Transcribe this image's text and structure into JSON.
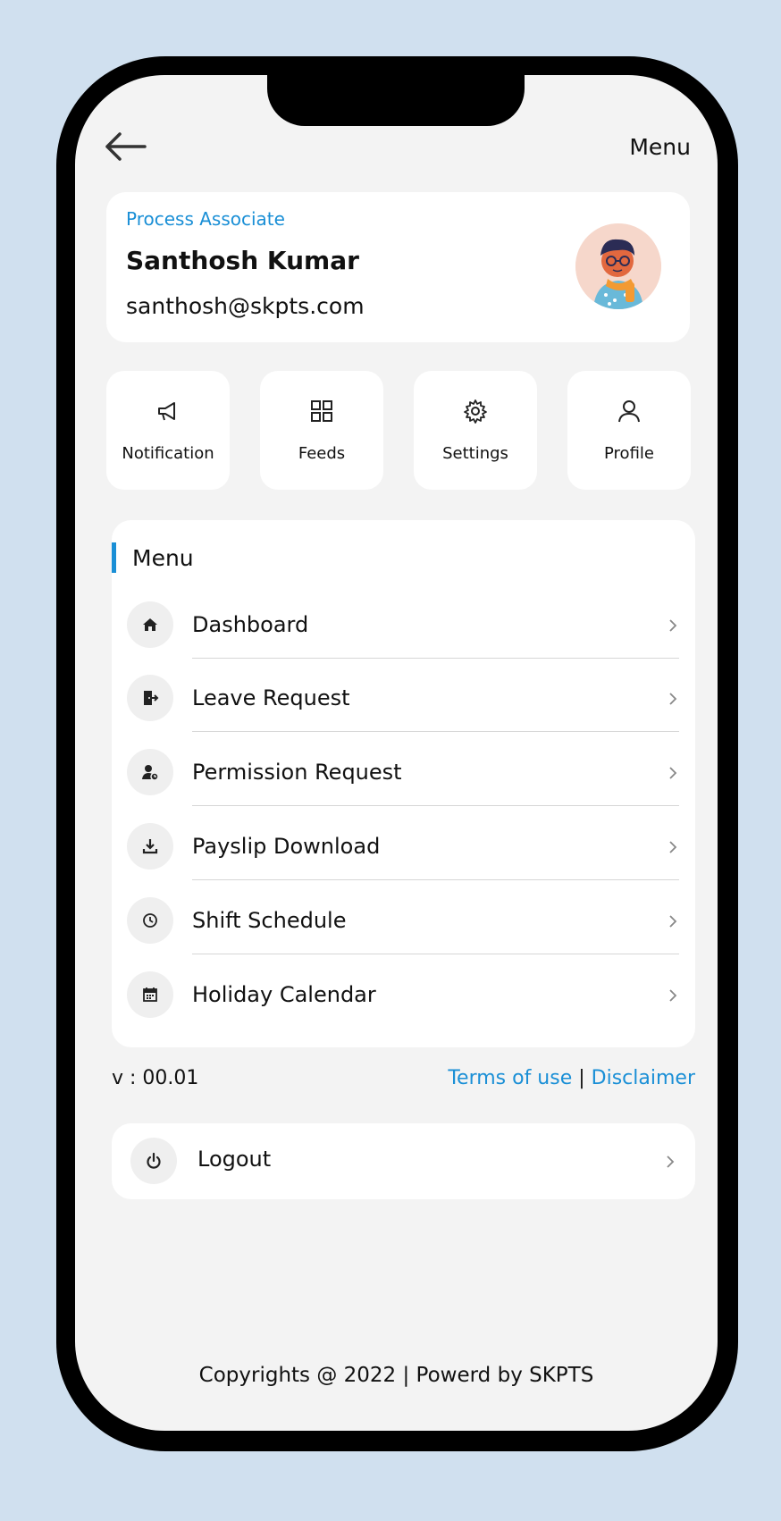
{
  "header": {
    "title": "Menu",
    "back_icon": "arrow-left-icon"
  },
  "profile": {
    "role": "Process Associate",
    "name": "Santhosh Kumar",
    "email": "santhosh@skpts.com",
    "avatar_icon": "user-avatar-illustration"
  },
  "quick_actions": [
    {
      "label": "Notification",
      "icon": "megaphone-icon"
    },
    {
      "label": "Feeds",
      "icon": "grid-icon"
    },
    {
      "label": "Settings",
      "icon": "gear-icon"
    },
    {
      "label": "Profile",
      "icon": "user-icon"
    }
  ],
  "menu": {
    "heading": "Menu",
    "items": [
      {
        "label": "Dashboard",
        "icon": "home-icon"
      },
      {
        "label": "Leave Request",
        "icon": "exit-door-icon"
      },
      {
        "label": "Permission Request",
        "icon": "user-clock-icon"
      },
      {
        "label": "Payslip Download",
        "icon": "download-icon"
      },
      {
        "label": "Shift Schedule",
        "icon": "clock-icon"
      },
      {
        "label": "Holiday Calendar",
        "icon": "calendar-icon"
      }
    ]
  },
  "footer_links": {
    "version": "v : 00.01",
    "terms": "Terms of use",
    "separator": "|",
    "disclaimer": "Disclaimer"
  },
  "logout": {
    "label": "Logout",
    "icon": "power-icon"
  },
  "copyright": "Copyrights @ 2022 | Powerd by SKPTS",
  "colors": {
    "accent": "#1a8fd6",
    "background": "#d0e0ef",
    "screen": "#f3f3f3"
  }
}
